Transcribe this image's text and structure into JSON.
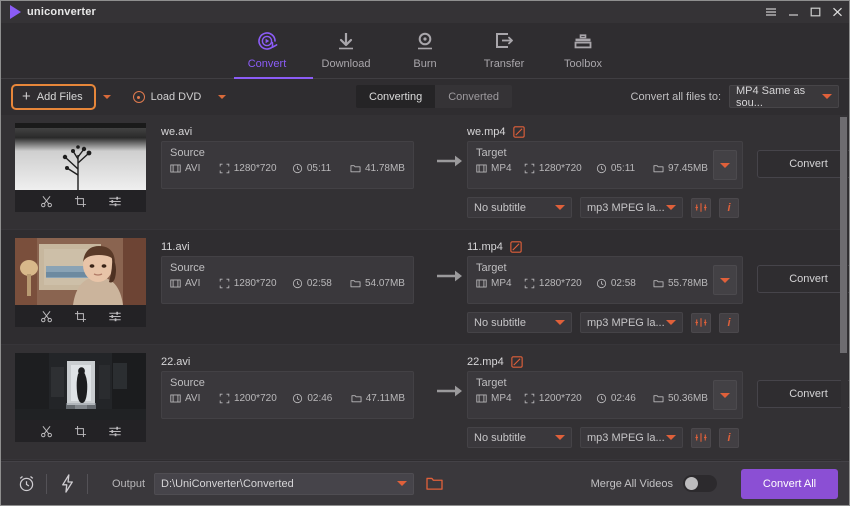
{
  "window": {
    "brand": "uniconverter",
    "controls": [
      {
        "name": "menu-button",
        "glyph": "≡"
      },
      {
        "name": "minimize-button",
        "glyph": "–"
      },
      {
        "name": "maximize-button",
        "glyph": "□"
      },
      {
        "name": "close-button",
        "glyph": "✕"
      }
    ]
  },
  "nav": {
    "tabs": [
      {
        "label": "Convert",
        "icon": "convert-icon",
        "active": true
      },
      {
        "label": "Download",
        "icon": "download-icon",
        "active": false
      },
      {
        "label": "Burn",
        "icon": "burn-icon",
        "active": false
      },
      {
        "label": "Transfer",
        "icon": "transfer-icon",
        "active": false
      },
      {
        "label": "Toolbox",
        "icon": "toolbox-icon",
        "active": false
      }
    ],
    "active_color": "#8b5cf6"
  },
  "toolbar": {
    "add_files_label": "Add Files",
    "load_dvd_label": "Load DVD",
    "highlight_color": "#e8873a",
    "tabs": [
      {
        "label": "Converting",
        "active": true
      },
      {
        "label": "Converted",
        "active": false
      }
    ],
    "convert_all_to_label": "Convert all files to:",
    "preset_value": "MP4 Same as sou..."
  },
  "files": [
    {
      "thumbnail": "plant-branch-grayscale",
      "tools": [
        "trim-icon",
        "crop-icon",
        "effect-icon"
      ],
      "source": {
        "filename": "we.avi",
        "label": "Source",
        "format": "AVI",
        "resolution": "1280*720",
        "duration": "05:11",
        "size": "41.78MB"
      },
      "target": {
        "filename": "we.mp4",
        "label": "Target",
        "format": "MP4",
        "resolution": "1280*720",
        "duration": "05:11",
        "size": "97.45MB"
      },
      "subtitle": "No subtitle",
      "audio": "mp3 MPEG la...",
      "convert_label": "Convert"
    },
    {
      "thumbnail": "woman-portrait-warm",
      "tools": [
        "trim-icon",
        "crop-icon",
        "effect-icon"
      ],
      "source": {
        "filename": "11.avi",
        "label": "Source",
        "format": "AVI",
        "resolution": "1280*720",
        "duration": "02:58",
        "size": "54.07MB"
      },
      "target": {
        "filename": "11.mp4",
        "label": "Target",
        "format": "MP4",
        "resolution": "1280*720",
        "duration": "02:58",
        "size": "55.78MB"
      },
      "subtitle": "No subtitle",
      "audio": "mp3 MPEG la...",
      "convert_label": "Convert"
    },
    {
      "thumbnail": "dark-corridor",
      "tools": [
        "trim-icon",
        "crop-icon",
        "effect-icon"
      ],
      "source": {
        "filename": "22.avi",
        "label": "Source",
        "format": "AVI",
        "resolution": "1200*720",
        "duration": "02:46",
        "size": "47.11MB"
      },
      "target": {
        "filename": "22.mp4",
        "label": "Target",
        "format": "MP4",
        "resolution": "1200*720",
        "duration": "02:46",
        "size": "50.36MB"
      },
      "subtitle": "No subtitle",
      "audio": "mp3 MPEG la...",
      "convert_label": "Convert"
    }
  ],
  "bottombar": {
    "output_label": "Output",
    "output_path": "D:\\UniConverter\\Converted",
    "merge_label": "Merge All Videos",
    "merge_enabled": false,
    "convert_all_label": "Convert All",
    "convert_all_color": "#8b4fd4"
  }
}
